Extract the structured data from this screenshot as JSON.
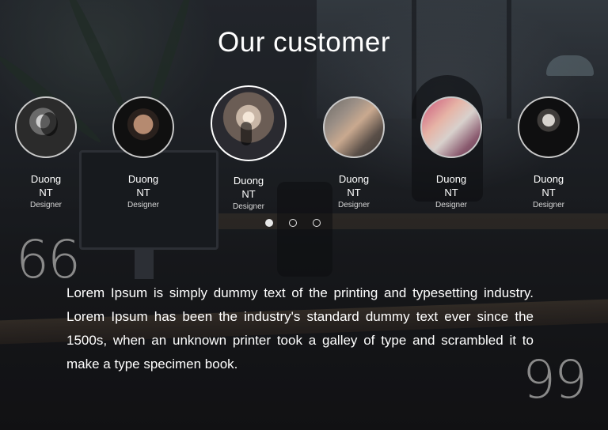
{
  "section": {
    "title": "Our customer",
    "quote_open": "66",
    "quote_close": "99",
    "testimonial": "Lorem Ipsum is simply dummy text of the printing and typesetting industry. Lorem Ipsum has been the industry's standard dummy text ever since the 1500s, when an unknown printer took a galley of type and scrambled it to make a type specimen book."
  },
  "customers": [
    {
      "name_first": "Duong",
      "name_last": "NT",
      "role": "Designer"
    },
    {
      "name_first": "Duong",
      "name_last": "NT",
      "role": "Designer"
    },
    {
      "name_first": "Duong",
      "name_last": "NT",
      "role": "Designer"
    },
    {
      "name_first": "Duong",
      "name_last": "NT",
      "role": "Designer"
    },
    {
      "name_first": "Duong",
      "name_last": "NT",
      "role": "Designer"
    },
    {
      "name_first": "Duong",
      "name_last": "NT",
      "role": "Designer"
    }
  ],
  "active_customer_index": 2,
  "pagination": {
    "pages": 3,
    "current": 1
  },
  "colors": {
    "text": "#ffffff",
    "quote_mark": "#8a8a8a",
    "dot": "#e8e8e8"
  }
}
